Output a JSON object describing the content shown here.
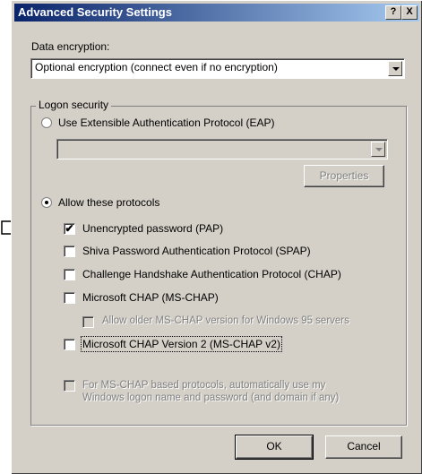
{
  "window": {
    "title": "Advanced Security Settings",
    "help_glyph": "?",
    "close_glyph": "X"
  },
  "data_encryption": {
    "label": "Data encryption:",
    "selected": "Optional encryption (connect even if no encryption)"
  },
  "logon_security": {
    "group_label": "Logon security",
    "eap_radio_label": "Use Extensible Authentication Protocol (EAP)",
    "eap_radio_selected": false,
    "eap_combo_value": "",
    "properties_button": "Properties",
    "protocols_radio_label": "Allow these protocols",
    "protocols_radio_selected": true,
    "protocols": [
      {
        "label": "Unencrypted password (PAP)",
        "checked": true,
        "enabled": true
      },
      {
        "label": "Shiva Password Authentication Protocol (SPAP)",
        "checked": false,
        "enabled": true
      },
      {
        "label": "Challenge Handshake Authentication Protocol (CHAP)",
        "checked": false,
        "enabled": true
      },
      {
        "label": "Microsoft CHAP (MS-CHAP)",
        "checked": false,
        "enabled": true
      },
      {
        "label": "Allow older MS-CHAP version for Windows 95 servers",
        "checked": false,
        "enabled": false
      },
      {
        "label": "Microsoft CHAP Version 2 (MS-CHAP v2)",
        "checked": false,
        "enabled": true
      }
    ],
    "auto_logon_line1": "For MS-CHAP based protocols, automatically use my",
    "auto_logon_line2": "Windows logon name and password (and domain if any)"
  },
  "buttons": {
    "ok": "OK",
    "cancel": "Cancel"
  },
  "check_glyph": "✔"
}
